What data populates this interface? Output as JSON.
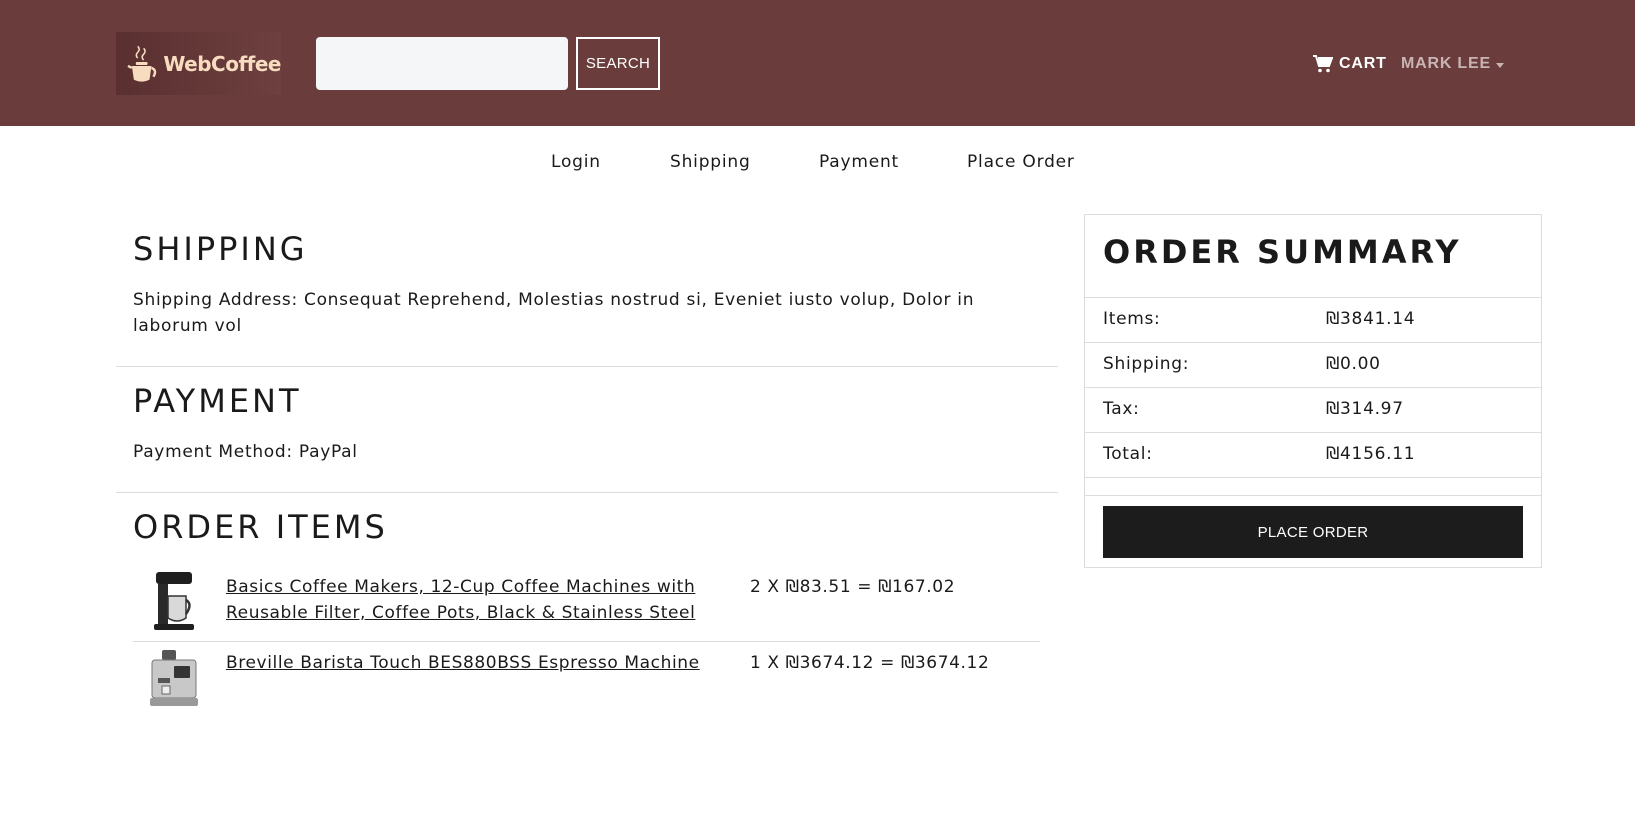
{
  "header": {
    "logo_text": "WebCoffee",
    "search": {
      "value": "",
      "placeholder": ""
    },
    "search_button": "SEARCH",
    "cart_label": "CART",
    "user_label": "MARK LEE"
  },
  "steps": [
    "Login",
    "Shipping",
    "Payment",
    "Place Order"
  ],
  "shipping": {
    "title": "SHIPPING",
    "address": "Shipping Address: Consequat Reprehend, Molestias nostrud si, Eveniet iusto volup, Dolor in laborum vol"
  },
  "payment": {
    "title": "PAYMENT",
    "method": "Payment Method: PayPal"
  },
  "order_items": {
    "title": "ORDER ITEMS",
    "items": [
      {
        "name": "Basics Coffee Makers, 12-Cup Coffee Machines with Reusable Filter, Coffee Pots, Black & Stainless Steel",
        "price": "2 X ₪83.51 = ₪167.02"
      },
      {
        "name": "Breville Barista Touch BES880BSS Espresso Machine",
        "price": "1 X ₪3674.12 = ₪3674.12"
      }
    ]
  },
  "summary": {
    "title": "ORDER SUMMARY",
    "rows": [
      {
        "label": "Items:",
        "value": "₪3841.14"
      },
      {
        "label": "Shipping:",
        "value": "₪0.00"
      },
      {
        "label": "Tax:",
        "value": "₪314.97"
      },
      {
        "label": "Total:",
        "value": "₪4156.11"
      }
    ],
    "button": "PLACE ORDER"
  },
  "colors": {
    "header_bg": "#6b3c3c",
    "logo_text": "#f7dcc0",
    "button_dark": "#1c1c1c"
  }
}
